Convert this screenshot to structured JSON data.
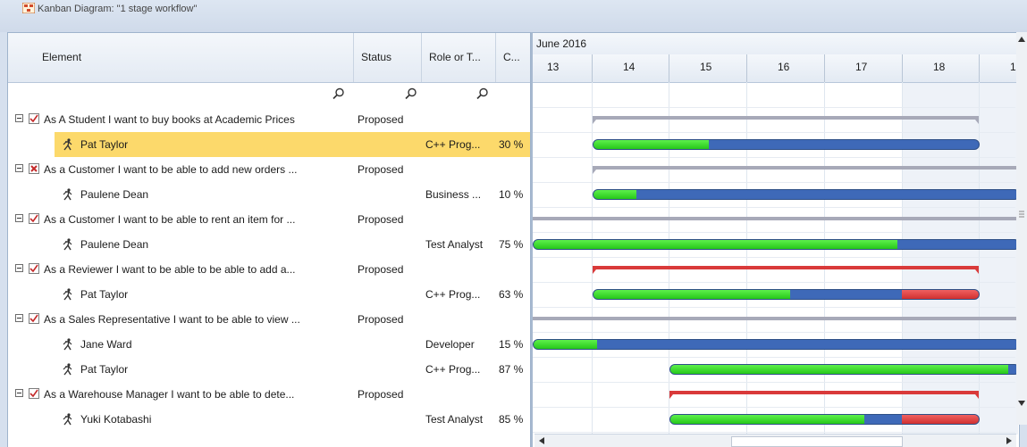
{
  "window": {
    "title": "Kanban Diagram: \"1 stage workflow\""
  },
  "grid": {
    "columns": [
      "Element",
      "Status",
      "Role or T...",
      "C..."
    ],
    "rows": [
      {
        "type": "element",
        "name": "As A Student I want to buy books at Academic Prices",
        "status": "Proposed",
        "checkbox": "check"
      },
      {
        "type": "resource",
        "name": "Pat Taylor",
        "role": "C++ Prog...",
        "complete": "30 %",
        "selected": true
      },
      {
        "type": "element",
        "name": "As a Customer I want to be able to add new orders ...",
        "status": "Proposed",
        "checkbox": "cross"
      },
      {
        "type": "resource",
        "name": "Paulene Dean",
        "role": "Business ...",
        "complete": "10 %"
      },
      {
        "type": "element",
        "name": "As a Customer I want to be able to rent an item for ...",
        "status": "Proposed",
        "checkbox": "check"
      },
      {
        "type": "resource",
        "name": "Paulene Dean",
        "role": "Test Analyst",
        "complete": "75 %"
      },
      {
        "type": "element",
        "name": "As a Reviewer I want to be able to be able to add a...",
        "status": "Proposed",
        "checkbox": "check"
      },
      {
        "type": "resource",
        "name": "Pat Taylor",
        "role": "C++ Prog...",
        "complete": "63 %"
      },
      {
        "type": "element",
        "name": "As a Sales Representative I want to be able to view ...",
        "status": "Proposed",
        "checkbox": "check"
      },
      {
        "type": "resource",
        "name": "Jane Ward",
        "role": "Developer",
        "complete": "15 %"
      },
      {
        "type": "resource",
        "name": "Pat Taylor",
        "role": "C++ Prog...",
        "complete": "87 %"
      },
      {
        "type": "element",
        "name": "As a Warehouse Manager I want to be able to dete...",
        "status": "Proposed",
        "checkbox": "check"
      },
      {
        "type": "resource",
        "name": "Yuki Kotabashi",
        "role": "Test Analyst",
        "complete": "85 %"
      }
    ]
  },
  "timeline": {
    "month": "June 2016",
    "days": [
      "13",
      "14",
      "15",
      "16",
      "17",
      "18",
      "1"
    ]
  },
  "colors": {
    "accent_selected": "#fcd96b",
    "progress_done": "#2fd11f",
    "progress_remaining": "#3e69b8",
    "overdue": "#d93a3a",
    "summary": "#a7a9b8"
  }
}
